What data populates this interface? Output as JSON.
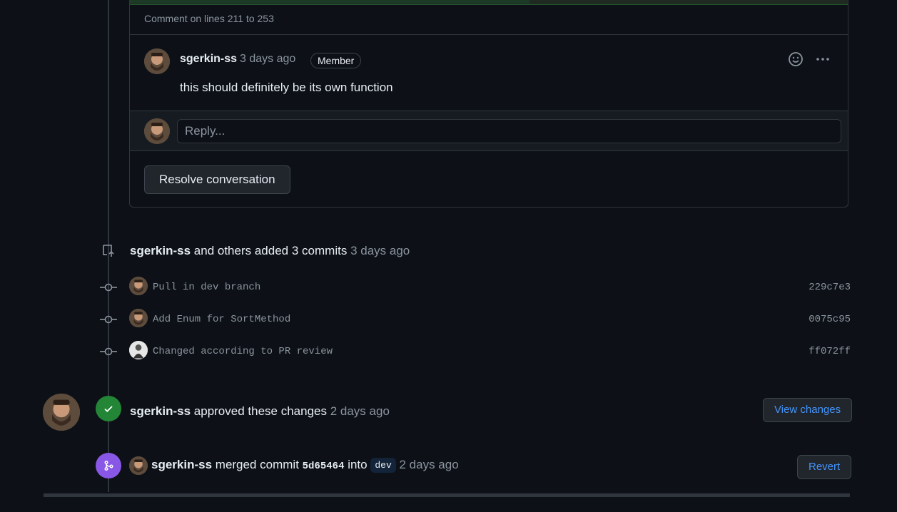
{
  "thread": {
    "comment_on_lines": "Comment on lines 211 to 253",
    "comment": {
      "author": "sgerkin-ss",
      "time": "3 days ago",
      "badge": "Member",
      "body": "this should definitely be its own function"
    },
    "reply_placeholder": "Reply...",
    "resolve_label": "Resolve conversation"
  },
  "commits_event": {
    "author": "sgerkin-ss",
    "text_mid": "and others added",
    "count_text": "3 commits",
    "time": "3 days ago",
    "commits": [
      {
        "message": "Pull in dev branch",
        "sha": "229c7e3"
      },
      {
        "message": "Add Enum for SortMethod",
        "sha": "0075c95"
      },
      {
        "message": "Changed according to PR review",
        "sha": "ff072ff"
      }
    ]
  },
  "approval_event": {
    "author": "sgerkin-ss",
    "text": "approved these changes",
    "time": "2 days ago",
    "button": "View changes"
  },
  "merge_event": {
    "author": "sgerkin-ss",
    "text": "merged commit",
    "sha": "5d65464",
    "into": "into",
    "branch": "dev",
    "time": "2 days ago",
    "button": "Revert"
  },
  "colors": {
    "background": "#0d1117",
    "approve_green": "#238636",
    "merge_purple": "#8957e5",
    "link_blue": "#4493f8"
  }
}
